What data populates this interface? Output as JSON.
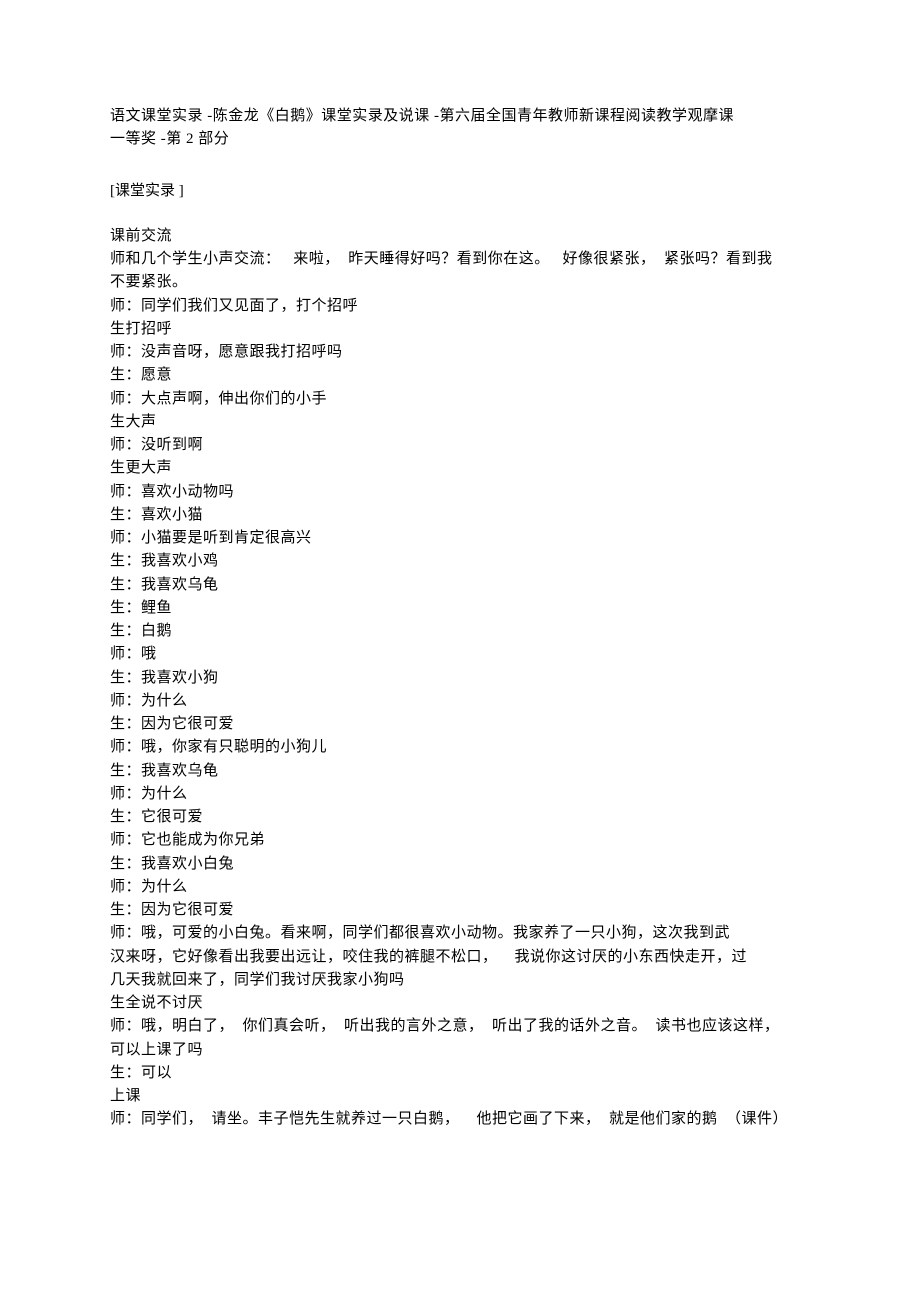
{
  "title_line1": "语文课堂实录  -陈金龙《白鹅》课堂实录及说课    -第六届全国青年教师新课程阅读教学观摩课",
  "title_line2": "一等奖 -第 2 部分",
  "section_header": "[课堂实录  ]",
  "lines": [
    "课前交流",
    "师和几个学生小声交流：   来啦，  昨天睡得好吗？看到你在这。   好像很紧张，  紧张吗？看到我",
    "不要紧张。",
    "师：同学们我们又见面了，打个招呼",
    "生打招呼",
    "师：没声音呀，愿意跟我打招呼吗",
    "生：愿意",
    "师：大点声啊，伸出你们的小手",
    "生大声",
    "师：没听到啊",
    "生更大声",
    "师：喜欢小动物吗",
    "生：喜欢小猫",
    "师：小猫要是听到肯定很高兴",
    "生：我喜欢小鸡",
    "生：我喜欢乌龟",
    "生：鲤鱼",
    "生：白鹅",
    "师：哦",
    "生：我喜欢小狗",
    "师：为什么",
    "生：因为它很可爱",
    "师：哦，你家有只聪明的小狗儿",
    "生：我喜欢乌龟",
    "师：为什么",
    "生：它很可爱",
    "师：它也能成为你兄弟",
    "生：我喜欢小白兔",
    "师：为什么",
    "生：因为它很可爱",
    "师：哦，可爱的小白兔。看来啊，同学们都很喜欢小动物。我家养了一只小狗，这次我到武",
    "汉来呀，它好像看出我要出远让，咬住我的裤腿不松口，    我说你这讨厌的小东西快走开，过",
    "几天我就回来了，同学们我讨厌我家小狗吗",
    "生全说不讨厌",
    "师：哦，明白了，  你们真会听，  听出我的言外之意，  听出了我的话外之音。  读书也应该这样，",
    "可以上课了吗",
    "生：可以",
    "上课",
    "师：同学们，  请坐。丰子恺先生就养过一只白鹅，    他把它画了下来，  就是他们家的鹅  （课件）"
  ]
}
